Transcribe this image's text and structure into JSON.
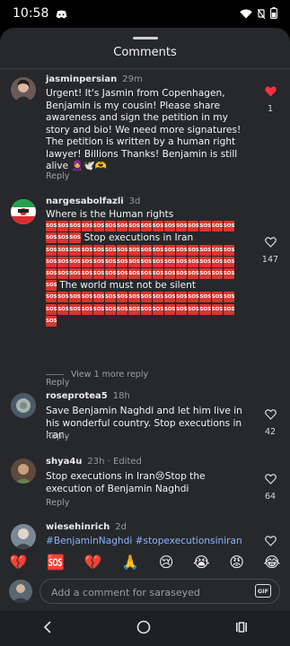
{
  "status": {
    "time": "10:58"
  },
  "sheet": {
    "title": "Comments"
  },
  "comments": [
    {
      "username": "jasminpersian",
      "time": "29m",
      "text": "Urgent! It's Jasmin from Copenhagen, Benjamin is my cousin! Please share awareness and sign the petition in my story and bio! We need more signatures! The petition is written by a human right lawyer! Billions Thanks! Benjamin is still alive 🧕🕊️🫶",
      "reply": "Reply",
      "likes": "1",
      "liked": true
    },
    {
      "username": "nargesabolfazli",
      "time": "3d",
      "line1": "Where is the Human rights",
      "sos_label": "SOS",
      "line2": "Stop executions in Iran",
      "line3": "The world must not be silent",
      "reply": "Reply",
      "likes": "147",
      "view_more": "View 1 more reply"
    },
    {
      "username": "roseprotea5",
      "time": "18h",
      "text": "Save Benjamin Naghdi and let him live in his wonderful country. Stop executions in Iran.",
      "reply": "Reply",
      "likes": "42"
    },
    {
      "username": "shya4u",
      "time": "23h · Edited",
      "text": "Stop executions in Iran😢Stop the execution of  Benjamin Naghdi",
      "reply": "Reply",
      "likes": "64"
    },
    {
      "username": "wiesehinrich",
      "time": "2d",
      "text": "#BenjaminNaghdi #stopexecutionsiniran"
    }
  ],
  "emoji_bar": [
    "💔",
    "🆘",
    "💔",
    "🙏",
    "😢",
    "😭",
    "😡",
    "😂"
  ],
  "input": {
    "placeholder": "Add a comment for saraseyed",
    "gif_label": "GIF"
  },
  "colors": {
    "like_red": "#ff3040",
    "sos_red": "#d8362f",
    "hashtag_blue": "#8ab4ff",
    "sheet_bg": "#26282b"
  }
}
